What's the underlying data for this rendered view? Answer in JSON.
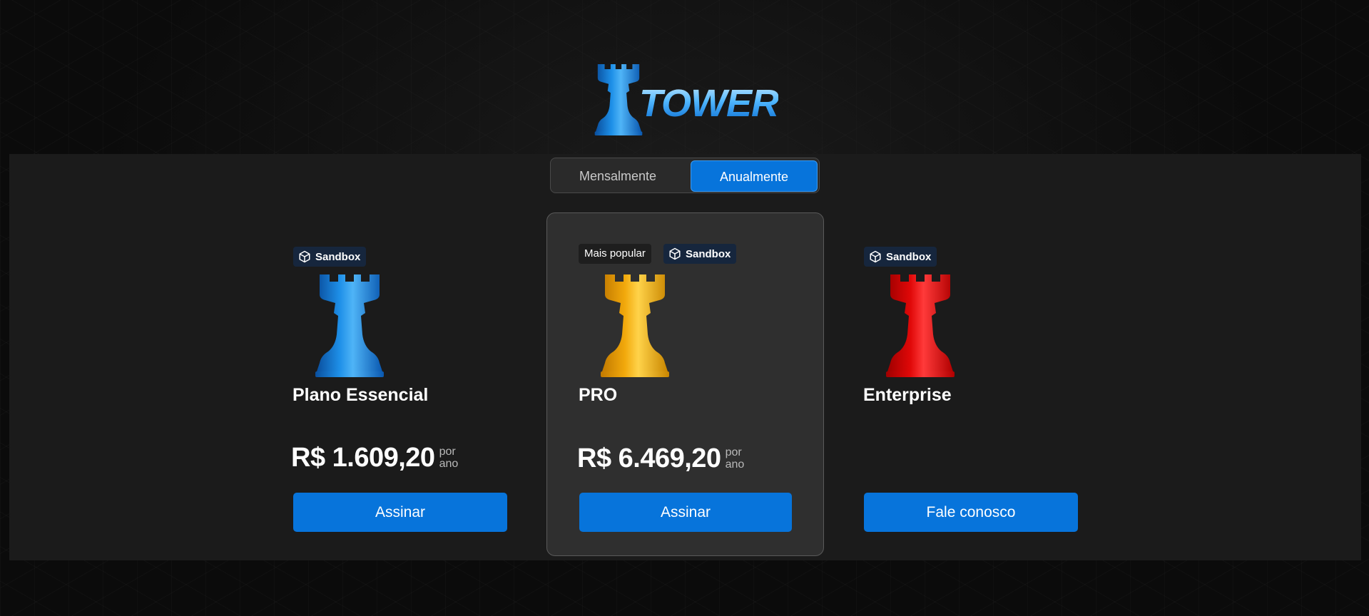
{
  "brand": {
    "name": "TOWER"
  },
  "billing_toggle": {
    "monthly_label": "Mensalmente",
    "yearly_label": "Anualmente",
    "selected": "Anualmente"
  },
  "plans": [
    {
      "name": "Plano Essencial",
      "badge": "Sandbox",
      "price": "R$ 1.609,20",
      "period_top": "por",
      "period_bottom": "ano",
      "cta": "Assinar",
      "rook_color": "blue"
    },
    {
      "name": "PRO",
      "popular_label": "Mais popular",
      "badge": "Sandbox",
      "price": "R$ 6.469,20",
      "period_top": "por",
      "period_bottom": "ano",
      "cta": "Assinar",
      "rook_color": "gold"
    },
    {
      "name": "Enterprise",
      "badge": "Sandbox",
      "cta": "Fale conosco",
      "rook_color": "red"
    }
  ],
  "colors": {
    "accent": "#0774db",
    "panel": "#1b1b1b",
    "highlight_card": "#2f2f2f",
    "badge_bg": "#16263d"
  },
  "icons": {
    "badge": "cube-icon",
    "plan_image": "chess-rook-icon"
  }
}
